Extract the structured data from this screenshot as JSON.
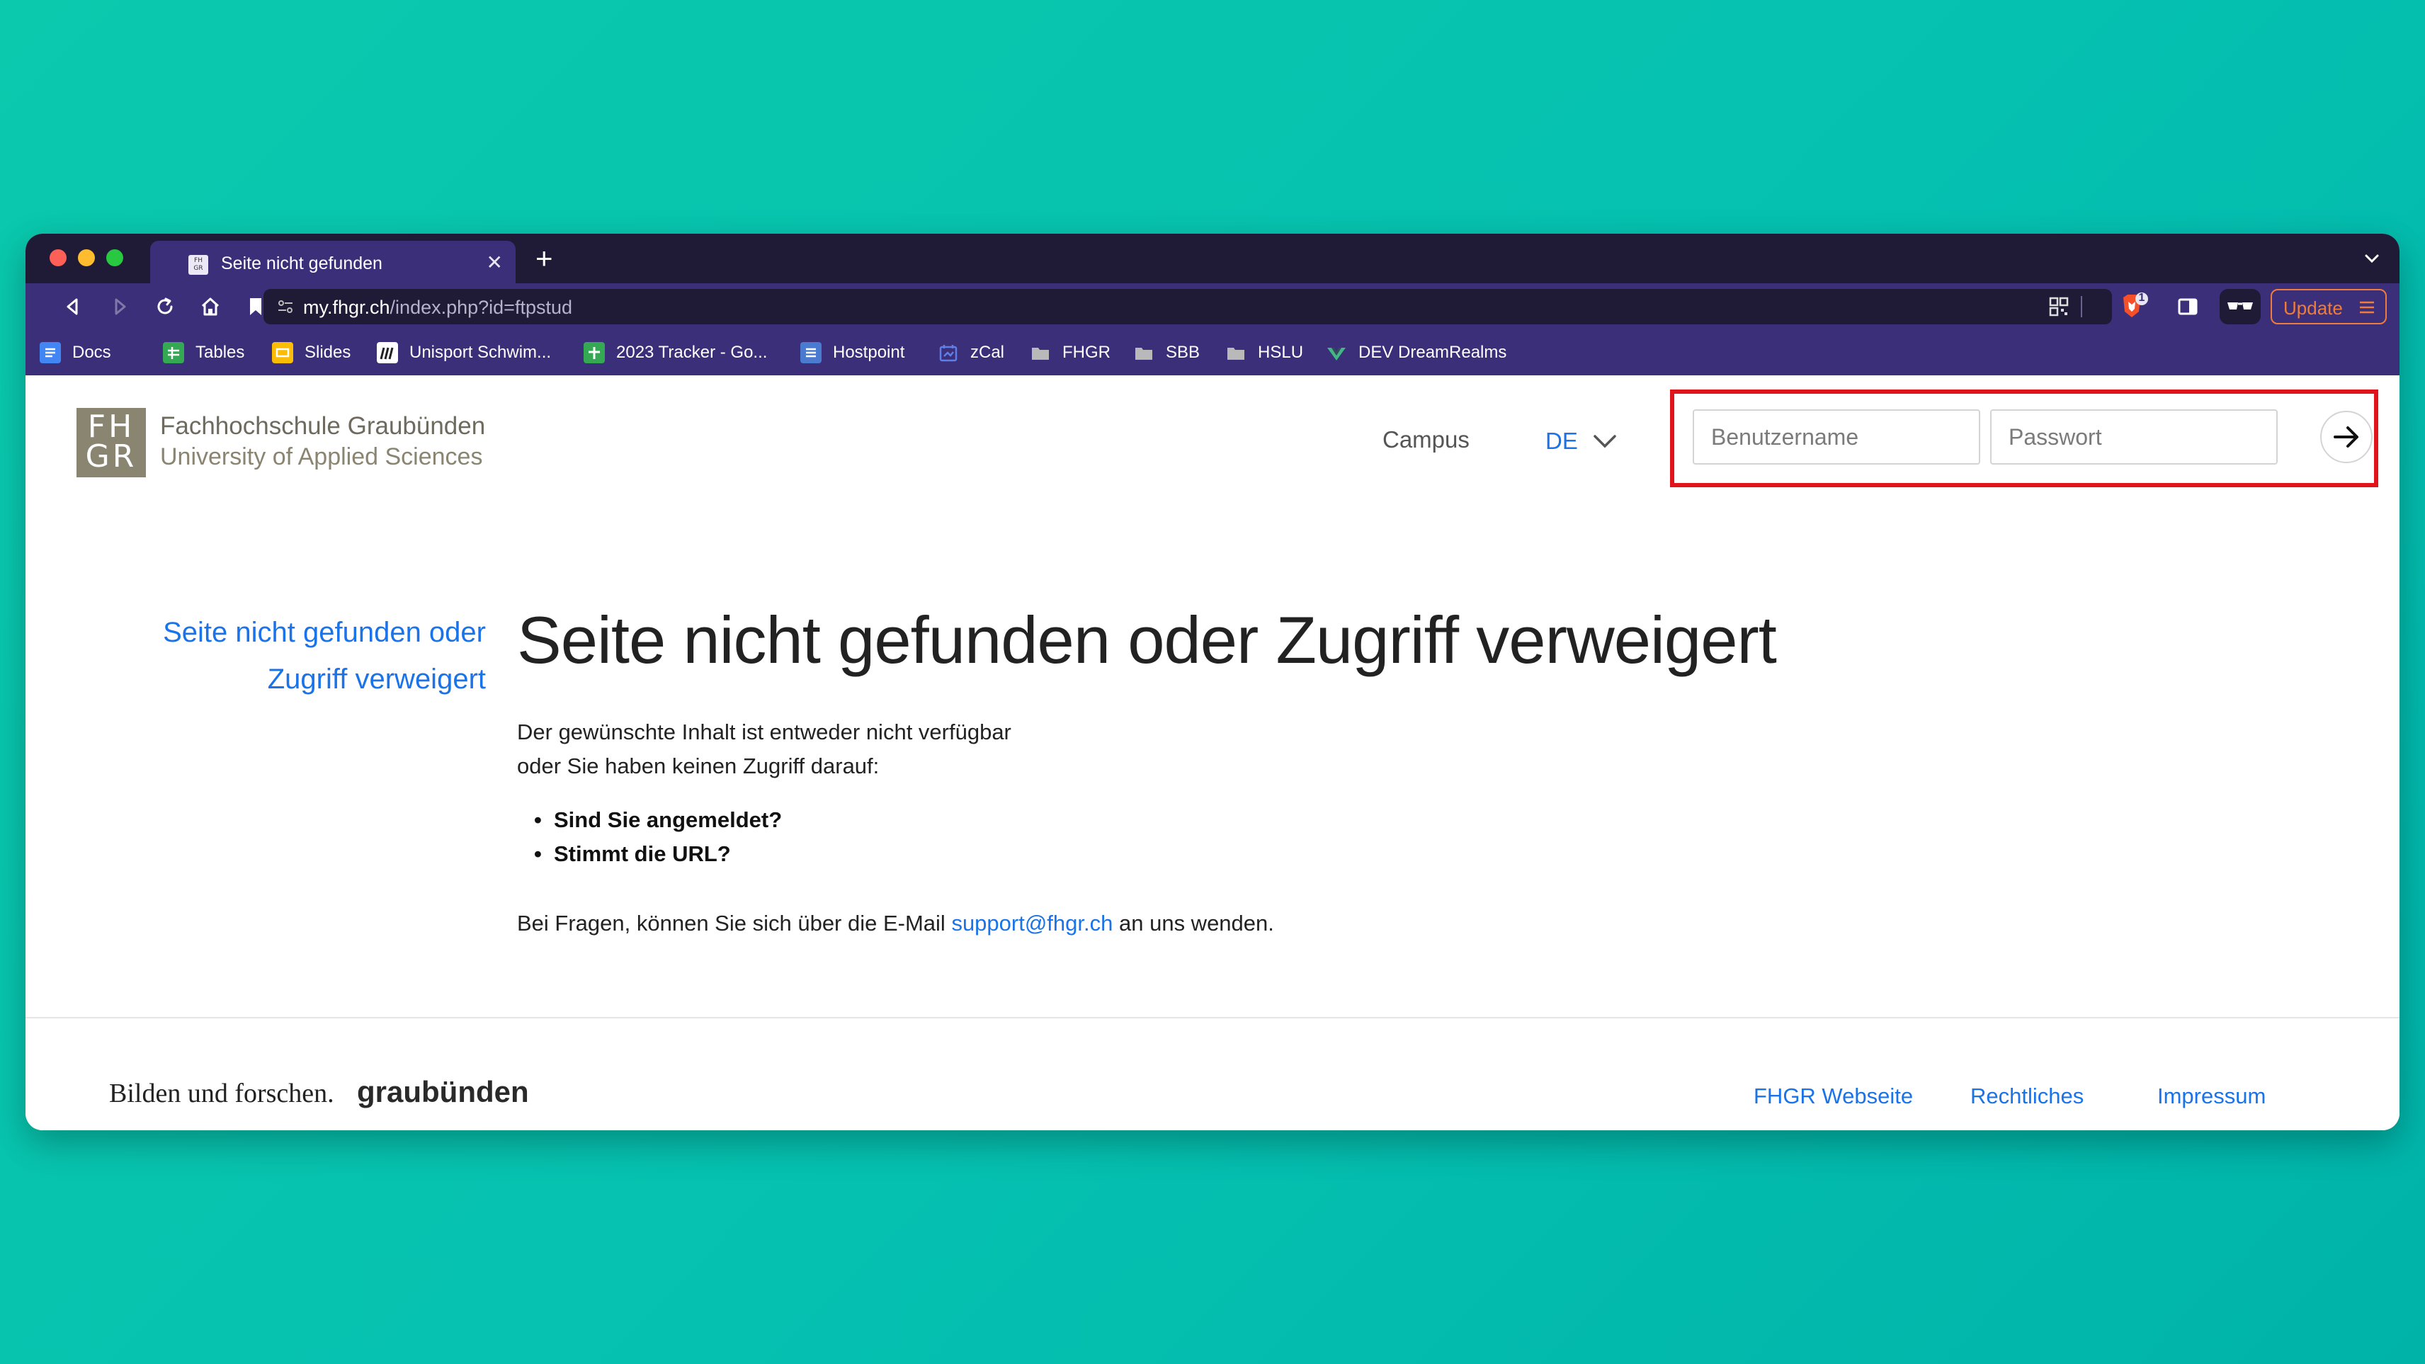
{
  "browser": {
    "tab_title": "Seite nicht gefunden",
    "tab_favicon_text": "FH GR",
    "url_host": "my.fhgr.ch",
    "url_path": "/index.php?id=ftpstud",
    "update_label": "Update",
    "brave_badge_count": "1",
    "bookmarks": [
      {
        "label": "Docs",
        "icon": "docs-icon",
        "color": "#4285f4"
      },
      {
        "label": "Tables",
        "icon": "tables-icon",
        "color": "#34a853"
      },
      {
        "label": "Slides",
        "icon": "slides-icon",
        "color": "#fbbc04"
      },
      {
        "label": "Unisport Schwim...",
        "icon": "unisport-icon",
        "color": "#ffffff"
      },
      {
        "label": "2023 Tracker - Go...",
        "icon": "sheets-icon",
        "color": "#34a853"
      },
      {
        "label": "Hostpoint",
        "icon": "hostpoint-icon",
        "color": "#4a7bd0"
      },
      {
        "label": "zCal",
        "icon": "zcal-icon",
        "color": "#5f7fe8"
      },
      {
        "label": "FHGR",
        "icon": "folder-icon",
        "color": "#b9b9b9"
      },
      {
        "label": "SBB",
        "icon": "folder-icon",
        "color": "#b9b9b9"
      },
      {
        "label": "HSLU",
        "icon": "folder-icon",
        "color": "#b9b9b9"
      },
      {
        "label": "DEV DreamRealms",
        "icon": "vue-icon",
        "color": "#41b883"
      }
    ]
  },
  "header": {
    "logo_top": "FH",
    "logo_bottom": "GR",
    "brand_name": "Fachhochschule Graubünden",
    "brand_subtitle": "University of Applied Sciences",
    "campus_label": "Campus",
    "language": "DE",
    "login": {
      "username_placeholder": "Benutzername",
      "password_placeholder": "Passwort"
    }
  },
  "main": {
    "sidenav_line1": "Seite nicht gefunden oder",
    "sidenav_line2": "Zugriff verweigert",
    "title": "Seite nicht gefunden oder Zugriff verweigert",
    "intro_line1": "Der gewünschte Inhalt ist entweder nicht verfügbar",
    "intro_line2": "oder Sie haben keinen Zugriff darauf:",
    "bullets": [
      "Sind Sie angemeldet?",
      "Stimmt die URL?"
    ],
    "contact_prefix": "Bei Fragen, können Sie sich über die E-Mail ",
    "contact_email": "support@fhgr.ch",
    "contact_suffix": " an uns wenden."
  },
  "footer": {
    "slogan": "Bilden und forschen.",
    "slogan_brand": "graubünden",
    "links": [
      "FHGR Webseite",
      "Rechtliches",
      "Impressum"
    ]
  },
  "colors": {
    "desktop_bg": "#05c1b0",
    "browser_chrome": "#3a2f78",
    "link_blue": "#1a73e8",
    "highlight_red": "#e0141b",
    "logo_olive": "#8a8571",
    "update_orange": "#f07c3c"
  }
}
